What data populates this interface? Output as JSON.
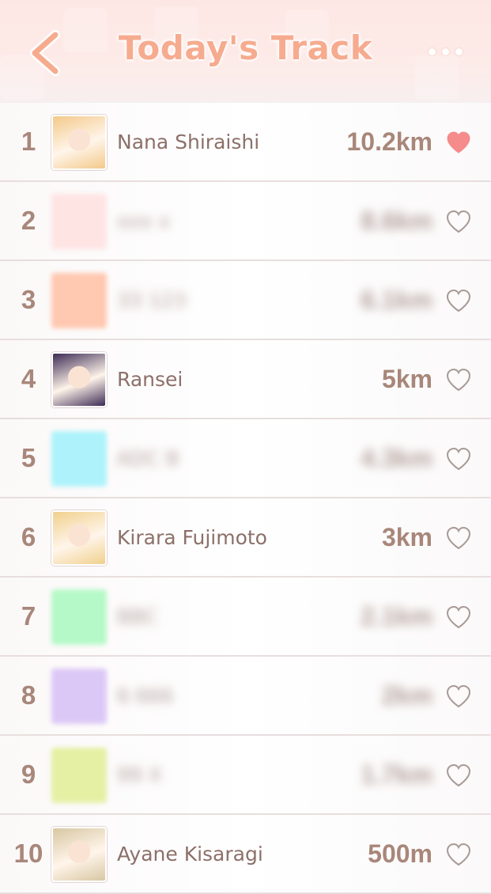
{
  "header": {
    "title": "Today's Track",
    "back_icon": "chevron-left-icon",
    "more_icon": "more-dots-icon"
  },
  "colors": {
    "accent": "#f6ab8f",
    "text": "#8c7069",
    "rank": "#a8877a",
    "heart_filled": "#f58b8b",
    "heart_outline": "#a89a96"
  },
  "leaderboard": [
    {
      "rank": "1",
      "name": "Nana Shiraishi",
      "distance": "10.2km",
      "liked": true,
      "hidden": false,
      "avatar": "#f3c98a"
    },
    {
      "rank": "2",
      "name": "xxx x",
      "distance": "8.6km",
      "liked": false,
      "hidden": true,
      "avatar": "#ffe4e4"
    },
    {
      "rank": "3",
      "name": "33 123",
      "distance": "6.1km",
      "liked": false,
      "hidden": true,
      "avatar": "#ffc8b1"
    },
    {
      "rank": "4",
      "name": "Ransei",
      "distance": "5km",
      "liked": false,
      "hidden": false,
      "avatar": "#3d2b55"
    },
    {
      "rank": "5",
      "name": "ADC B",
      "distance": "4.3km",
      "liked": false,
      "hidden": true,
      "avatar": "#aef3fb"
    },
    {
      "rank": "6",
      "name": "Kirara Fujimoto",
      "distance": "3km",
      "liked": false,
      "hidden": false,
      "avatar": "#f0d08d"
    },
    {
      "rank": "7",
      "name": "BBC",
      "distance": "2.1km",
      "liked": false,
      "hidden": true,
      "avatar": "#b6f9c8"
    },
    {
      "rank": "8",
      "name": "6 666",
      "distance": "2km",
      "liked": false,
      "hidden": true,
      "avatar": "#dcc8f6"
    },
    {
      "rank": "9",
      "name": "99 X",
      "distance": "1.7km",
      "liked": false,
      "hidden": true,
      "avatar": "#e5f0a4"
    },
    {
      "rank": "10",
      "name": "Ayane Kisaragi",
      "distance": "500m",
      "liked": false,
      "hidden": false,
      "avatar": "#d8c7a3"
    }
  ]
}
